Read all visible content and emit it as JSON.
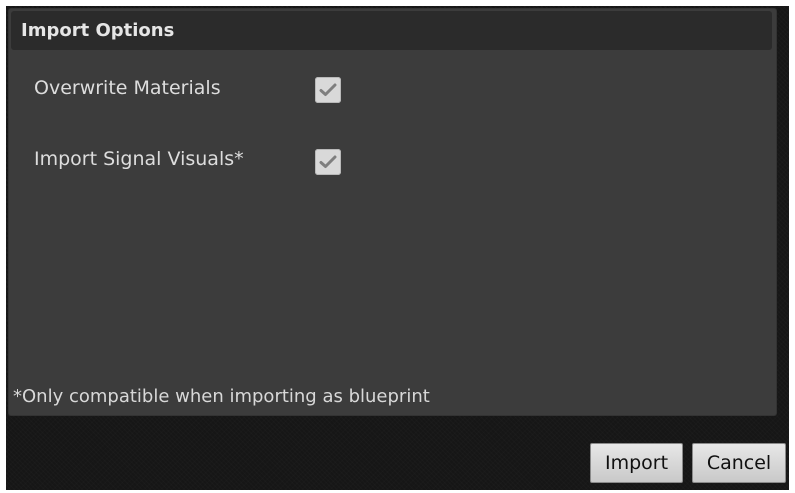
{
  "dialog": {
    "title": "Import Options",
    "options": [
      {
        "label": "Overwrite Materials",
        "checked": true
      },
      {
        "label": "Import Signal Visuals*",
        "checked": true
      }
    ],
    "footnote": "*Only compatible when importing as blueprint",
    "buttons": {
      "import_label": "Import",
      "cancel_label": "Cancel"
    }
  },
  "icons": {
    "checkmark": "check-icon"
  },
  "colors": {
    "background": "#161616",
    "panel": "#3c3c3c",
    "header": "#2b2b2b",
    "text": "#dddddd",
    "checkbox": "#d9d9d9",
    "button": "#d8d8d8"
  }
}
